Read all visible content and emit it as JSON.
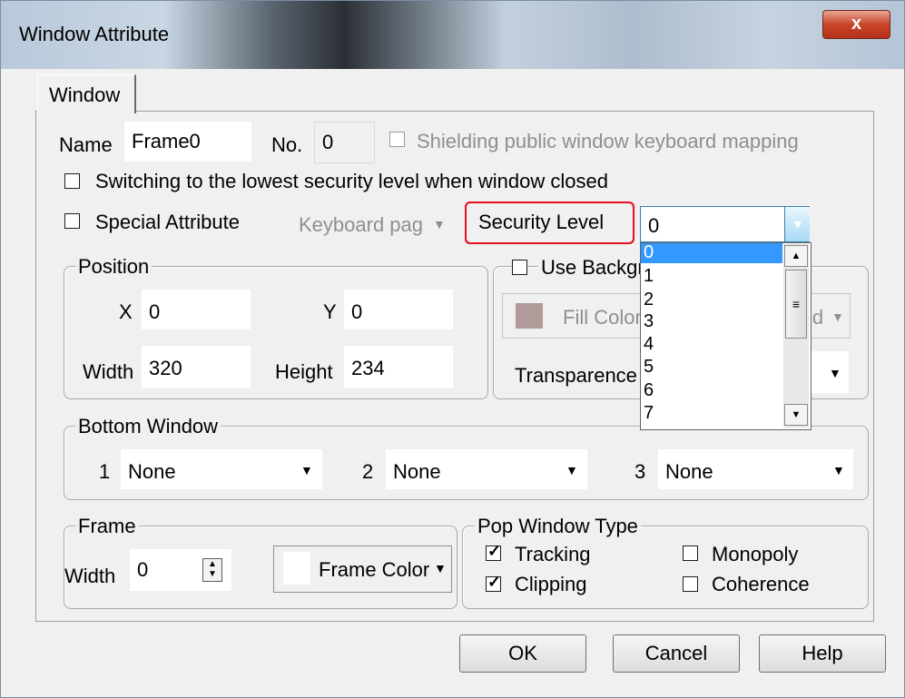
{
  "window": {
    "title": "Window Attribute",
    "close_label": "x"
  },
  "tab": {
    "label": "Window"
  },
  "name_row": {
    "name_label": "Name",
    "name_value": "Frame0",
    "no_label": "No.",
    "no_value": "0",
    "shield_label": "Shielding public window keyboard mapping"
  },
  "switch_label": "Switching to the lowest security level when window closed",
  "special": {
    "label": "Special Attribute",
    "combo_value": "Keyboard pag"
  },
  "security": {
    "label": "Security Level",
    "value": "0",
    "options": [
      "0",
      "1",
      "2",
      "3",
      "4",
      "5",
      "6",
      "7"
    ],
    "selected": "0"
  },
  "position": {
    "title": "Position",
    "x_label": "X",
    "x_value": "0",
    "y_label": "Y",
    "y_value": "0",
    "width_label": "Width",
    "width_value": "320",
    "height_label": "Height",
    "height_value": "234"
  },
  "background": {
    "use_label": "Use Backgr",
    "fill_label": "Fill Color",
    "fill_color": "#b09a9a",
    "right_combo": "id",
    "transparence_label": "Transparence"
  },
  "bottom_window": {
    "title": "Bottom Window",
    "slots": [
      {
        "num": "1",
        "value": "None"
      },
      {
        "num": "2",
        "value": "None"
      },
      {
        "num": "3",
        "value": "None"
      }
    ]
  },
  "frame": {
    "title": "Frame",
    "width_label": "Width",
    "width_value": "0",
    "color_label": "Frame Color"
  },
  "pop_type": {
    "title": "Pop Window Type",
    "tracking": "Tracking",
    "monopoly": "Monopoly",
    "clipping": "Clipping",
    "coherence": "Coherence"
  },
  "buttons": {
    "ok": "OK",
    "cancel": "Cancel",
    "help": "Help"
  },
  "colors": {
    "highlight": "#3399ff",
    "red_outline": "#e81123"
  }
}
